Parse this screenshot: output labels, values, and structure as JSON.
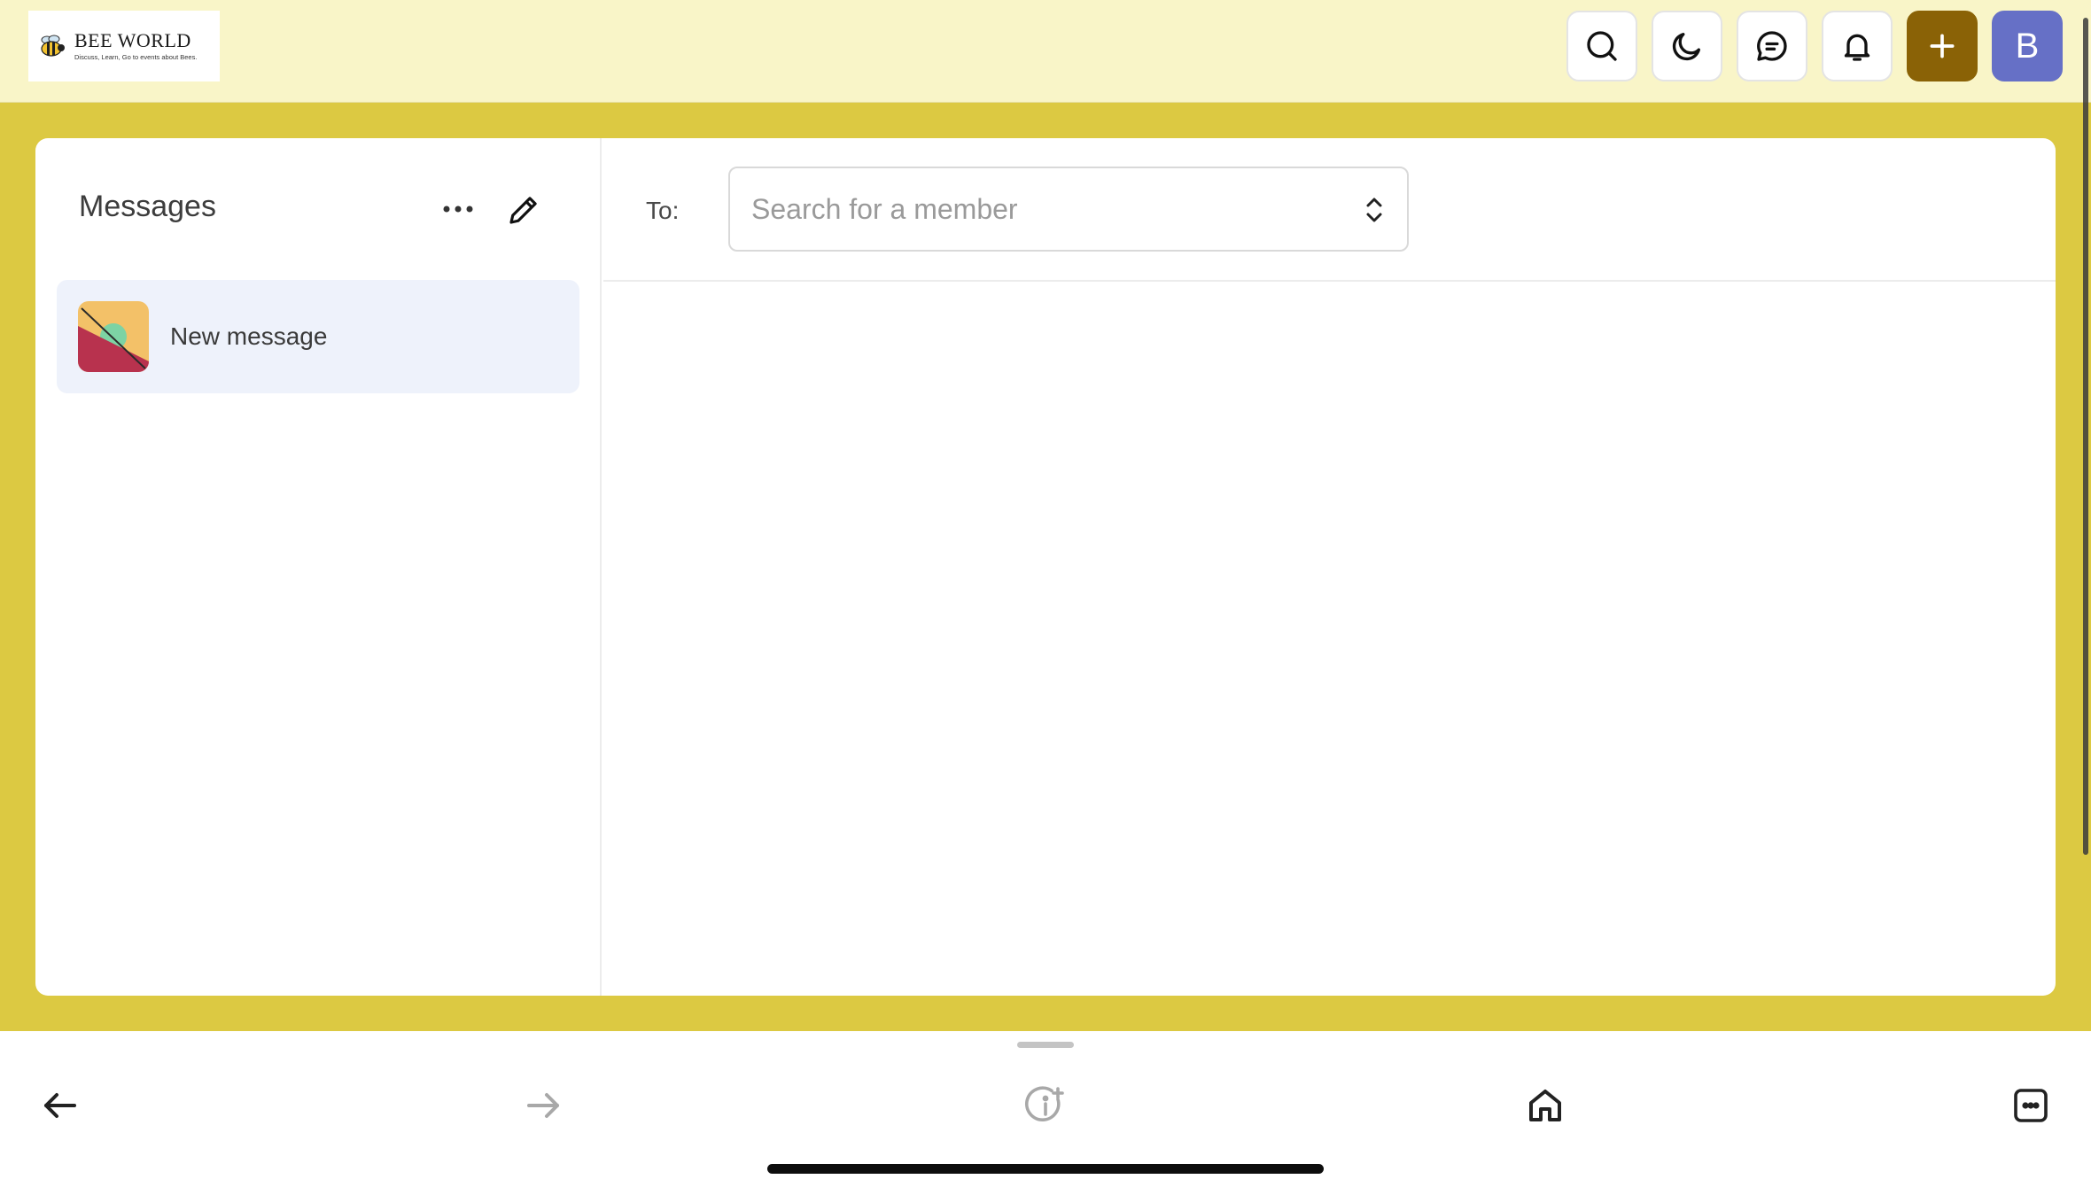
{
  "header": {
    "logo": {
      "title": "BEE WORLD",
      "subtitle": "Discuss, Learn, Go to events about Bees."
    },
    "buttons": [
      {
        "name": "search",
        "icon": "search-icon"
      },
      {
        "name": "dark-mode",
        "icon": "moon-icon"
      },
      {
        "name": "chat",
        "icon": "chat-icon"
      },
      {
        "name": "notifications",
        "icon": "bell-icon"
      },
      {
        "name": "create",
        "icon": "plus-icon"
      },
      {
        "name": "profile",
        "label": "B"
      }
    ],
    "colors": {
      "bar": "#f9f5c8",
      "plus_button": "#8a6206",
      "avatar": "#6670c6"
    }
  },
  "page_background": "#dcc942",
  "sidebar": {
    "title": "Messages",
    "more_icon": "ellipsis-icon",
    "compose_icon": "pencil-icon",
    "conversations": [
      {
        "label": "New message",
        "selected": true
      }
    ]
  },
  "compose": {
    "to_label": "To:",
    "member_search": {
      "placeholder": "Search for a member",
      "value": ""
    }
  },
  "browser_toolbar": {
    "items": [
      "back-arrow-icon",
      "forward-arrow-icon",
      "info-sparkle-icon",
      "home-icon",
      "tabs-icon"
    ]
  }
}
